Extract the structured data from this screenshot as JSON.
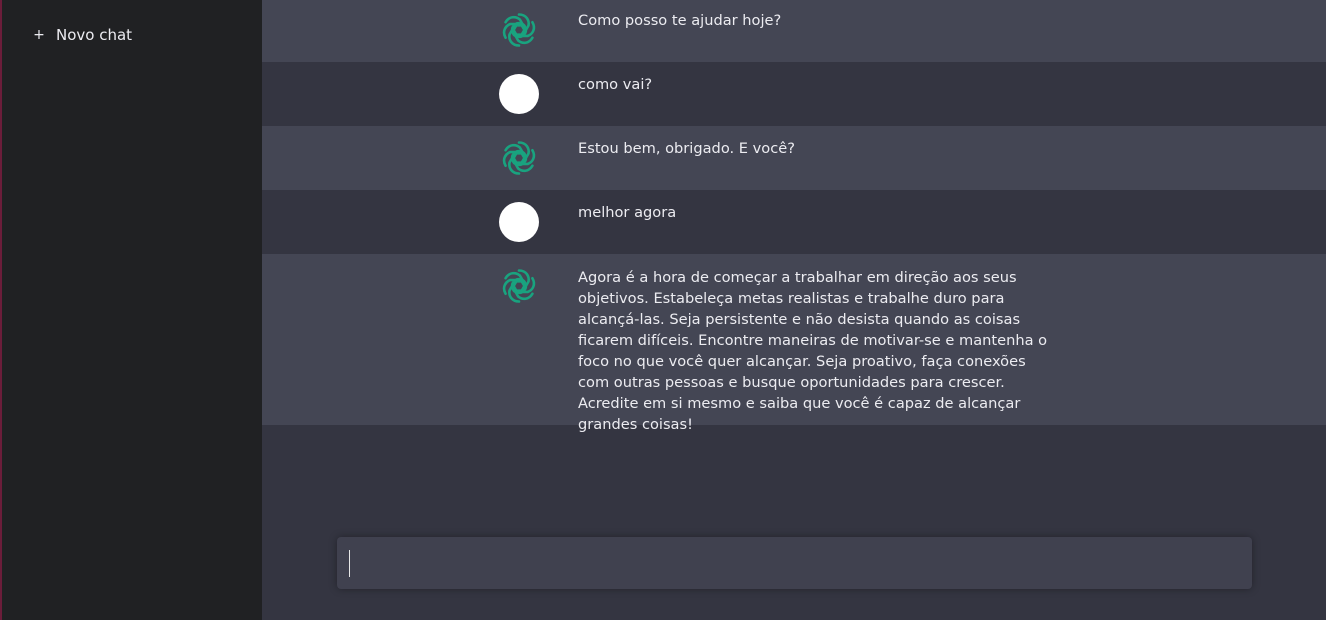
{
  "sidebar": {
    "new_chat_icon": "plus-icon",
    "new_chat_glyph": "+",
    "new_chat_label": "Novo chat"
  },
  "colors": {
    "sidebar_bg": "#202123",
    "main_bg": "#343541",
    "bot_row_bg": "#444654",
    "input_bg": "#40414f",
    "bot_logo": "#19a37f",
    "user_avatar": "#ffffff"
  },
  "messages": [
    {
      "role": "assistant",
      "avatar_icon": "openai-logo-icon",
      "text": "Como posso te ajudar hoje?"
    },
    {
      "role": "user",
      "avatar_icon": "user-avatar",
      "text": "como vai?"
    },
    {
      "role": "assistant",
      "avatar_icon": "openai-logo-icon",
      "text": "Estou bem, obrigado. E você?"
    },
    {
      "role": "user",
      "avatar_icon": "user-avatar",
      "text": "melhor agora"
    },
    {
      "role": "assistant",
      "avatar_icon": "openai-logo-icon",
      "text": "Agora é a hora de começar a trabalhar em direção aos seus objetivos. Estabeleça metas realistas e trabalhe duro para alcançá-las. Seja persistente e não desista quando as coisas ficarem difíceis. Encontre maneiras de motivar-se e mantenha o foco no que você quer alcançar. Seja proativo, faça conexões com outras pessoas e busque oportunidades para crescer. Acredite em si mesmo e saiba que você é capaz de alcançar grandes coisas!"
    }
  ],
  "composer": {
    "value": "",
    "placeholder": ""
  }
}
